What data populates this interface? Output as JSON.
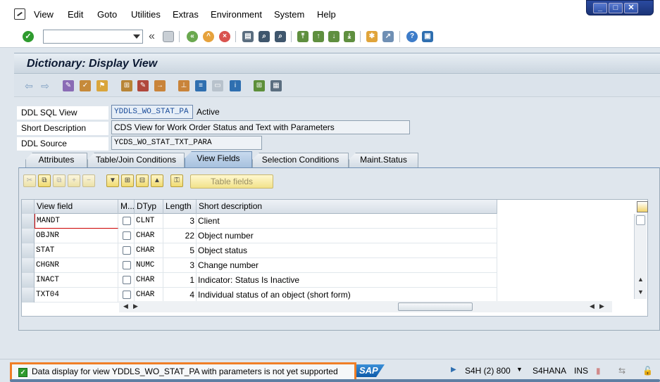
{
  "menubar": {
    "items": [
      "View",
      "Edit",
      "Goto",
      "Utilities",
      "Extras",
      "Environment",
      "System",
      "Help"
    ]
  },
  "window_controls": [
    "minimize",
    "maximize",
    "close"
  ],
  "toolbar": {
    "command_field_value": "",
    "back_label": "«"
  },
  "screen": {
    "title": "Dictionary: Display View"
  },
  "fields": {
    "ddl_sql_view_label": "DDL SQL View",
    "ddl_sql_view_value": "YDDLS_WO_STAT_PA",
    "status": "Active",
    "short_description_label": "Short Description",
    "short_description_value": "CDS View for Work Order Status and Text with Parameters",
    "ddl_source_label": "DDL Source",
    "ddl_source_value": "YCDS_WO_STAT_TXT_PARA"
  },
  "tabs": [
    {
      "label": "Attributes",
      "active": false
    },
    {
      "label": "Table/Join Conditions",
      "active": false
    },
    {
      "label": "View Fields",
      "active": true
    },
    {
      "label": "Selection Conditions",
      "active": false
    },
    {
      "label": "Maint.Status",
      "active": false
    }
  ],
  "grid_toolbar": {
    "table_fields_label": "Table fields"
  },
  "grid": {
    "columns": [
      "View field",
      "M...",
      "DTyp",
      "Length",
      "Short description"
    ],
    "rows": [
      {
        "field": "MANDT",
        "dtyp": "CLNT",
        "length": "3",
        "desc": "Client"
      },
      {
        "field": "OBJNR",
        "dtyp": "CHAR",
        "length": "22",
        "desc": "Object number"
      },
      {
        "field": "STAT",
        "dtyp": "CHAR",
        "length": "5",
        "desc": "Object status"
      },
      {
        "field": "CHGNR",
        "dtyp": "NUMC",
        "length": "3",
        "desc": "Change number"
      },
      {
        "field": "INACT",
        "dtyp": "CHAR",
        "length": "1",
        "desc": "Indicator: Status Is Inactive"
      },
      {
        "field": "TXT04",
        "dtyp": "CHAR",
        "length": "4",
        "desc": "Individual status of an object (short form)"
      }
    ]
  },
  "statusbar": {
    "message": "Data display for view YDDLS_WO_STAT_PA with parameters is not yet supported",
    "sap_logo": "SAP",
    "system": "S4H (2) 800",
    "server": "S4HANA",
    "mode": "INS"
  },
  "colors": {
    "accent": "#f07e26",
    "success": "#2e9b2e",
    "title_bg": "#cbd6e0"
  }
}
